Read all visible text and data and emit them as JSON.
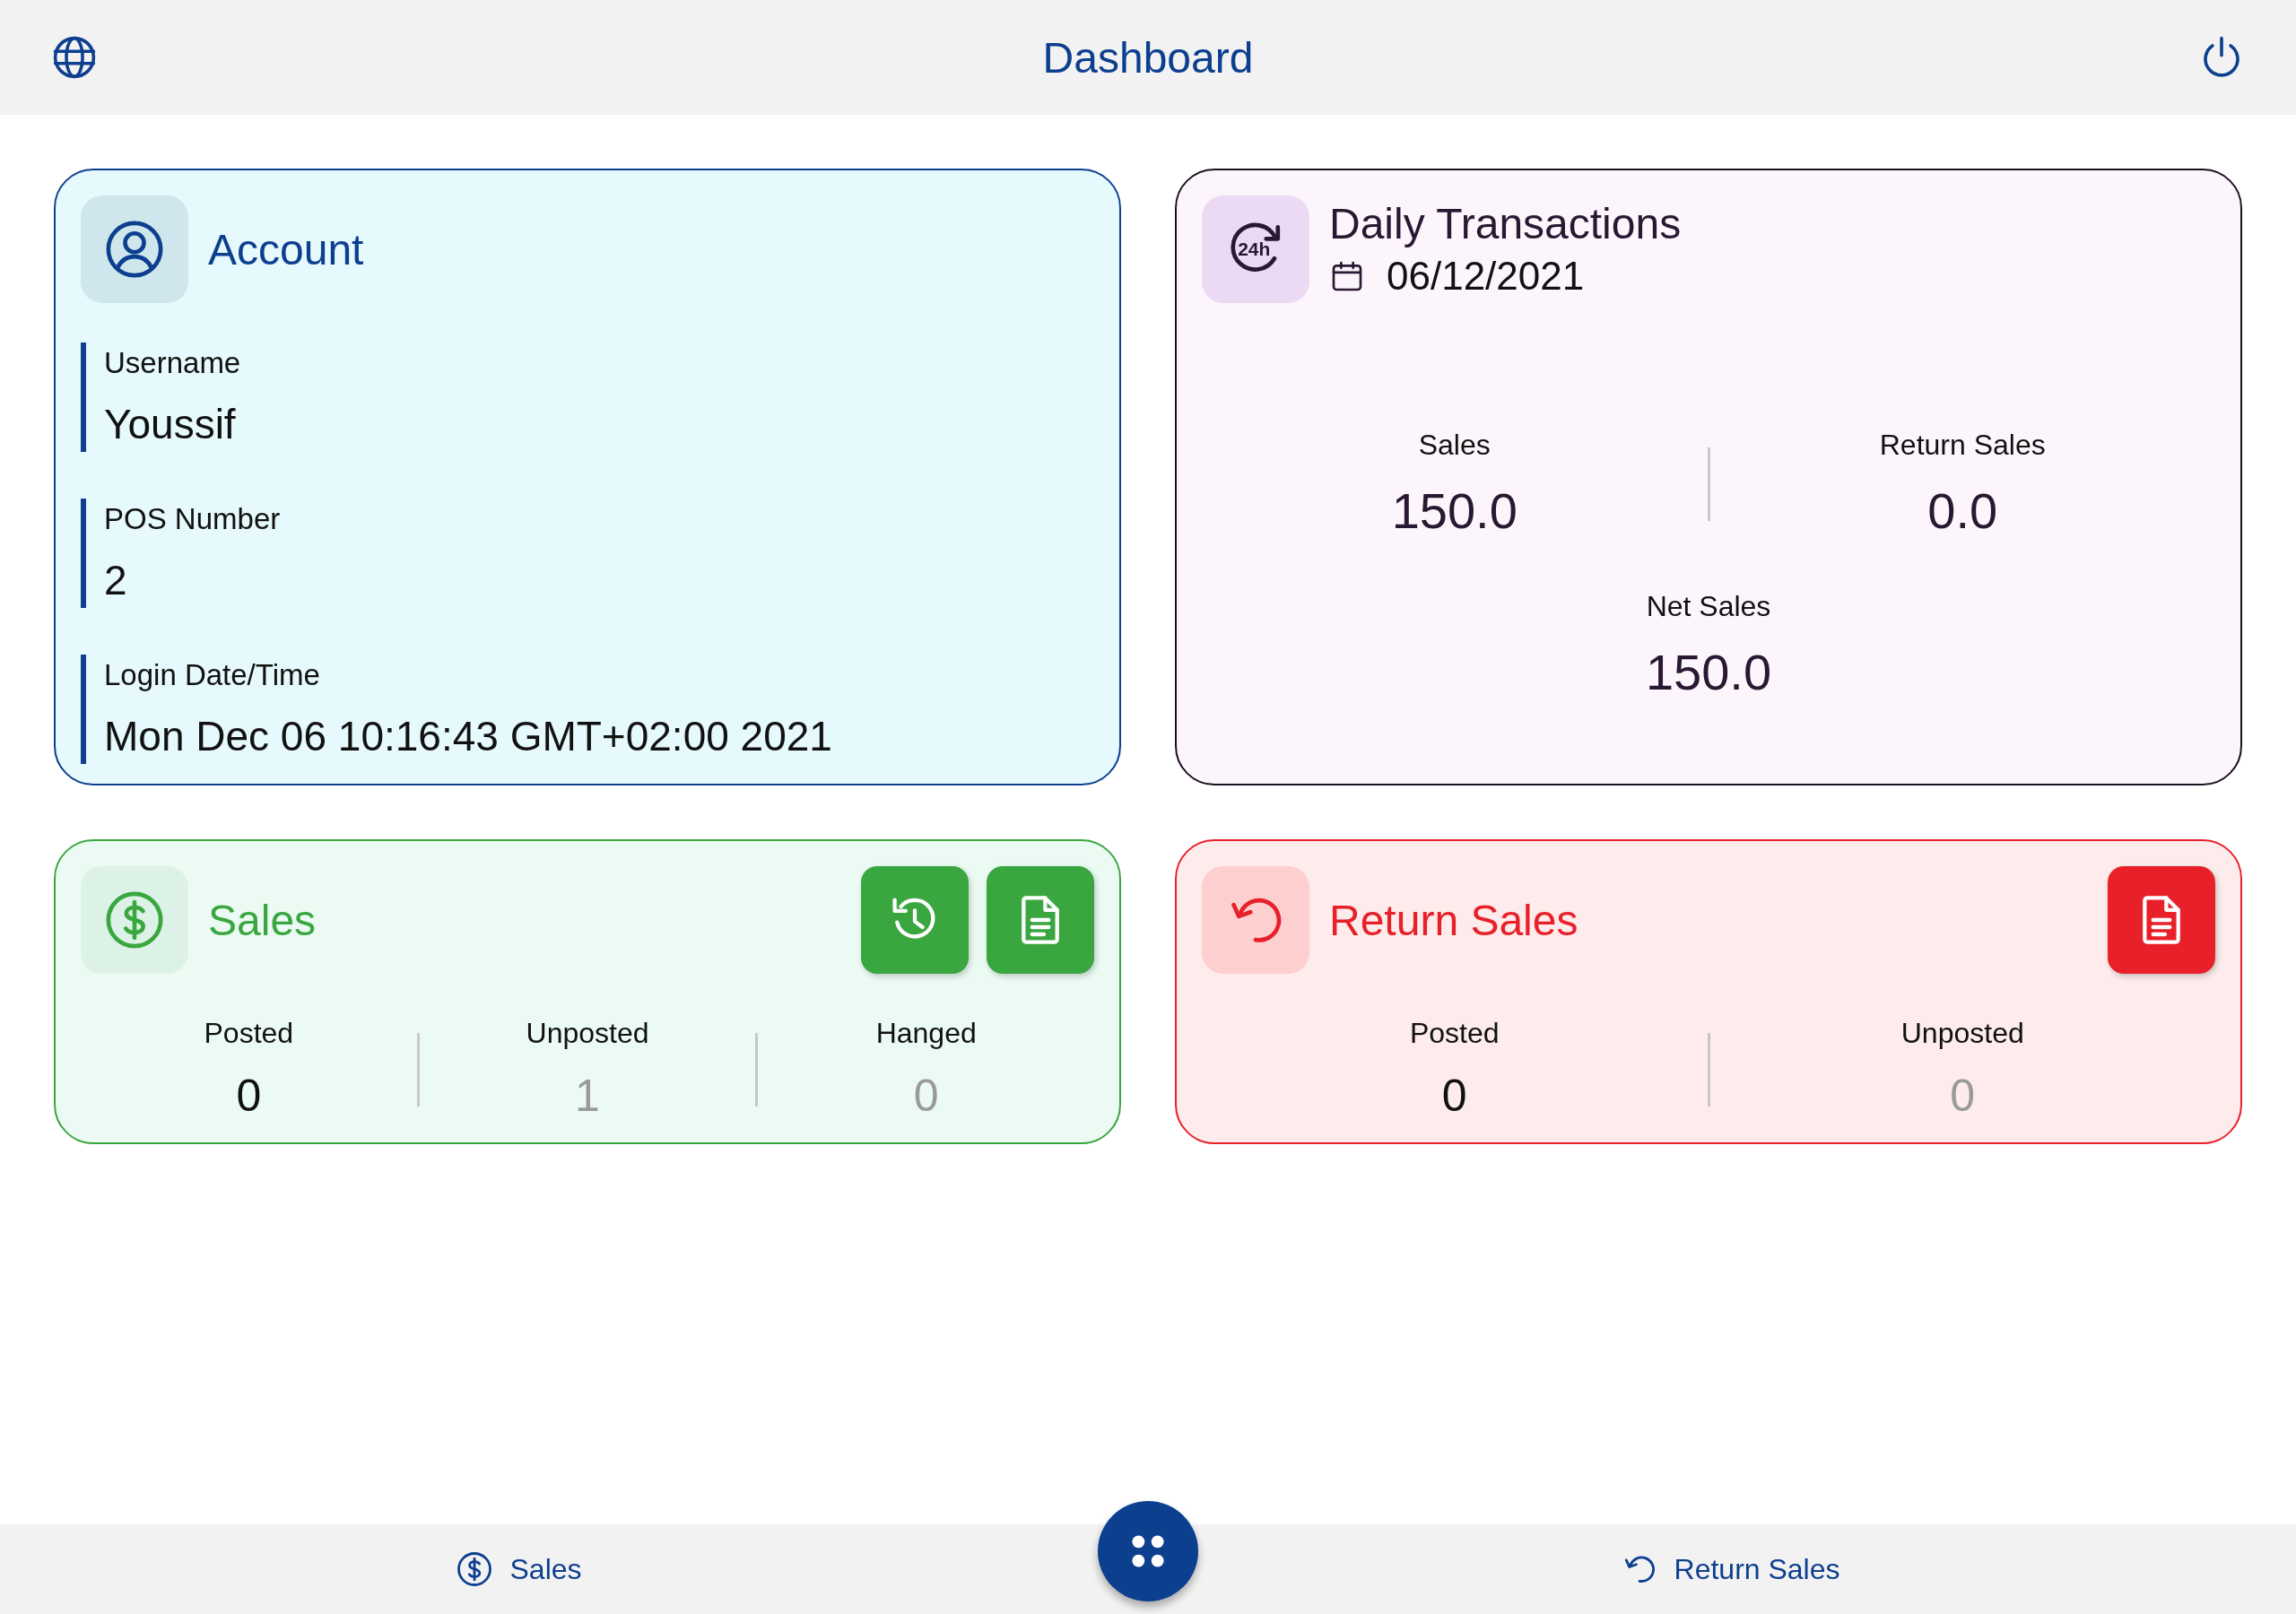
{
  "header": {
    "title": "Dashboard"
  },
  "account": {
    "title": "Account",
    "fields": [
      {
        "label": "Username",
        "value": "Youssif"
      },
      {
        "label": "POS Number",
        "value": "2"
      },
      {
        "label": "Login Date/Time",
        "value": "Mon Dec 06 10:16:43 GMT+02:00 2021"
      }
    ]
  },
  "daily": {
    "icon_text": "24h",
    "title": "Daily Transactions",
    "date": "06/12/2021",
    "stats": [
      {
        "label": "Sales",
        "value": "150.0"
      },
      {
        "label": "Return Sales",
        "value": "0.0"
      }
    ],
    "net": {
      "label": "Net Sales",
      "value": "150.0"
    }
  },
  "sales": {
    "title": "Sales",
    "buttons": [
      {
        "kind": "history"
      },
      {
        "kind": "report"
      }
    ],
    "stats": [
      {
        "label": "Posted",
        "value": "0",
        "muted": false
      },
      {
        "label": "Unposted",
        "value": "1",
        "muted": true
      },
      {
        "label": "Hanged",
        "value": "0",
        "muted": true
      }
    ]
  },
  "return_sales": {
    "title": "Return Sales",
    "buttons": [
      {
        "kind": "report"
      }
    ],
    "stats": [
      {
        "label": "Posted",
        "value": "0",
        "muted": false
      },
      {
        "label": "Unposted",
        "value": "0",
        "muted": true
      }
    ]
  },
  "bottom_nav": {
    "items": [
      {
        "label": "Sales",
        "kind": "sales"
      },
      {
        "label": "Return Sales",
        "kind": "return"
      }
    ]
  }
}
